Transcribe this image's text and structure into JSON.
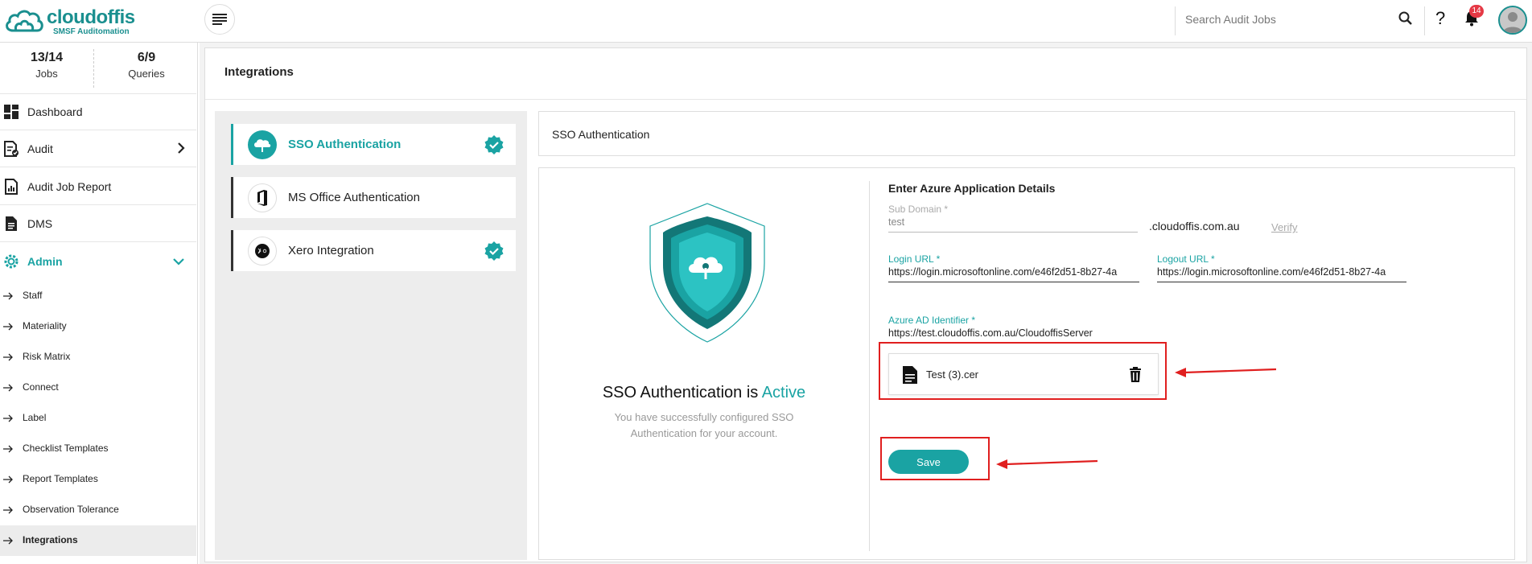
{
  "brand": {
    "name": "cloudoffis",
    "tagline": "SMSF Auditomation",
    "color": "#1a8f8f"
  },
  "topbar": {
    "search_placeholder": "Search Audit Jobs",
    "help_label": "?",
    "notification_count": "14"
  },
  "stats": [
    {
      "value": "13/14",
      "label": "Jobs"
    },
    {
      "value": "6/9",
      "label": "Queries"
    }
  ],
  "nav": {
    "dashboard": "Dashboard",
    "audit": "Audit",
    "audit_job_report": "Audit Job Report",
    "dms": "DMS",
    "admin": "Admin"
  },
  "admin_items": [
    "Staff",
    "Materiality",
    "Risk Matrix",
    "Connect",
    "Label",
    "Checklist Templates",
    "Report Templates",
    "Observation Tolerance",
    "Integrations"
  ],
  "page": {
    "title": "Integrations"
  },
  "integrations": [
    {
      "label": "SSO Authentication",
      "active": true,
      "verified": true
    },
    {
      "label": "MS Office Authentication",
      "active": false,
      "verified": false
    },
    {
      "label": "Xero Integration",
      "active": false,
      "verified": true
    }
  ],
  "panel": {
    "header": "SSO Authentication",
    "status_prefix": "SSO Authentication is",
    "status_word": "Active",
    "status_desc": "You have successfully configured SSO Authentication for your account."
  },
  "form": {
    "title": "Enter Azure Application Details",
    "sub_domain_label": "Sub Domain *",
    "sub_domain_value": "test",
    "domain_suffix": ".cloudoffis.com.au",
    "verify_label": "Verify",
    "login_url_label": "Login URL",
    "login_url_value": "https://login.microsoftonline.com/e46f2d51-8b27-4a",
    "logout_url_label": "Logout URL",
    "logout_url_value": "https://login.microsoftonline.com/e46f2d51-8b27-4a",
    "azure_id_label": "Azure AD Identifier",
    "azure_id_value": "https://test.cloudoffis.com.au/CloudoffisServer",
    "required_mark": "*",
    "file_name": "Test (3).cer",
    "save_label": "Save"
  },
  "colors": {
    "accent": "#1aa3a3",
    "annotation": "#e01f1f",
    "badge": "#e53945"
  }
}
